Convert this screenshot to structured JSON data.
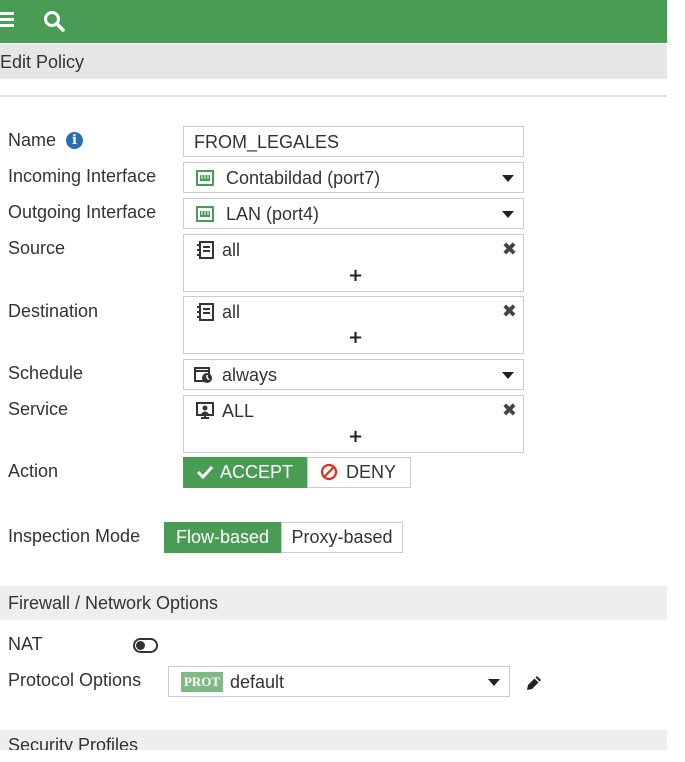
{
  "page_title": "Edit Policy",
  "form": {
    "name": {
      "label": "Name",
      "value": "FROM_LEGALES"
    },
    "incoming": {
      "label": "Incoming Interface",
      "value": "Contabildad (port7)",
      "icon": "port-icon"
    },
    "outgoing": {
      "label": "Outgoing Interface",
      "value": "LAN (port4)",
      "icon": "port-icon"
    },
    "source": {
      "label": "Source",
      "value": "all",
      "icon": "address-icon",
      "add": "+",
      "remove": "✖"
    },
    "destination": {
      "label": "Destination",
      "value": "all",
      "icon": "address-icon",
      "add": "+",
      "remove": "✖"
    },
    "schedule": {
      "label": "Schedule",
      "value": "always",
      "icon": "schedule-icon"
    },
    "service": {
      "label": "Service",
      "value": "ALL",
      "icon": "service-icon",
      "add": "+",
      "remove": "✖"
    },
    "action": {
      "label": "Action",
      "accept": "ACCEPT",
      "deny": "DENY",
      "selected": "ACCEPT"
    },
    "inspection": {
      "label": "Inspection Mode",
      "flow": "Flow-based",
      "proxy": "Proxy-based",
      "selected": "Flow-based"
    }
  },
  "firewall_section": {
    "title": "Firewall / Network Options",
    "nat": {
      "label": "NAT",
      "enabled": false
    },
    "protocol_options": {
      "label": "Protocol Options",
      "badge": "PROT",
      "value": "default"
    }
  },
  "security_section": {
    "title": "Security Profiles"
  },
  "colors": {
    "brand_green": "#4a9c55",
    "badge_green": "#80b886",
    "info_blue": "#2c6fb0",
    "deny_red": "#d93025"
  }
}
